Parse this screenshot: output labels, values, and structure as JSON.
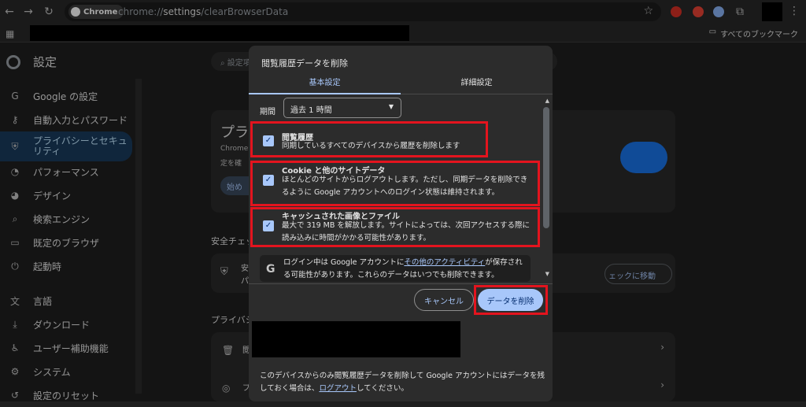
{
  "browser": {
    "chip_label": "Chrome",
    "url_scheme": "chrome://",
    "url_host": "settings",
    "url_path": "/clearBrowserData",
    "bookmarks_all": "すべてのブックマーク"
  },
  "sidebar": {
    "title": "設定",
    "items": [
      {
        "label": "Google の設定",
        "icon": "google-icon"
      },
      {
        "label": "自動入力とパスワード",
        "icon": "key-icon"
      },
      {
        "label": "プライバシーとセキュリティ",
        "icon": "shield-icon"
      },
      {
        "label": "パフォーマンス",
        "icon": "gauge-icon"
      },
      {
        "label": "デザイン",
        "icon": "palette-icon"
      },
      {
        "label": "検索エンジン",
        "icon": "search-icon"
      },
      {
        "label": "既定のブラウザ",
        "icon": "browser-icon"
      },
      {
        "label": "起動時",
        "icon": "power-icon"
      },
      {
        "label": "言語",
        "icon": "language-icon"
      },
      {
        "label": "ダウンロード",
        "icon": "download-icon"
      },
      {
        "label": "ユーザー補助機能",
        "icon": "accessibility-icon"
      },
      {
        "label": "システム",
        "icon": "wrench-icon"
      },
      {
        "label": "設定のリセット",
        "icon": "reset-icon"
      }
    ]
  },
  "main": {
    "search_placeholder": "設定項",
    "card_title": "プラ",
    "card_text1": "Chrome",
    "card_text2": "定を確",
    "card_button": "始め",
    "safety_heading": "安全チェッ",
    "safety_row1": "安",
    "safety_row2": "パ",
    "safety_button": "ェックに移動",
    "privacy_heading": "プライバシ",
    "row1_label": "閲",
    "row2_label": "プ"
  },
  "dialog": {
    "title": "閲覧履歴データを削除",
    "tab_basic": "基本設定",
    "tab_advanced": "詳細設定",
    "period_label": "期間",
    "period_value": "過去 1 時間",
    "options": [
      {
        "title": "閲覧履歴",
        "desc": "同期しているすべてのデバイスから履歴を削除します",
        "checked": true
      },
      {
        "title": "Cookie と他のサイトデータ",
        "desc": "ほとんどのサイトからログアウトします。ただし、同期データを削除できるように Google アカウントへのログイン状態は維持されます。",
        "checked": true
      },
      {
        "title": "キャッシュされた画像とファイル",
        "desc": "最大で 319 MB を解放します。サイトによっては、次回アクセスする際に読み込みに時間がかかる可能性があります。",
        "checked": true
      }
    ],
    "info_pre": "ログイン中は Google アカウントに",
    "info_link": "その他のアクティビティ",
    "info_post": "が保存される可能性があります。これらのデータはいつでも削除できます。",
    "cancel_label": "キャンセル",
    "delete_label": "データを削除",
    "footer_pre": "このデバイスからのみ閲覧履歴データを削除して Google アカウントにはデータを残しておく場合は、",
    "footer_link": "ログアウト",
    "footer_post": "してください。"
  },
  "colors": {
    "accent": "#a8c7fa",
    "highlight_box": "#e3141e",
    "background": "#1f1f1f"
  }
}
